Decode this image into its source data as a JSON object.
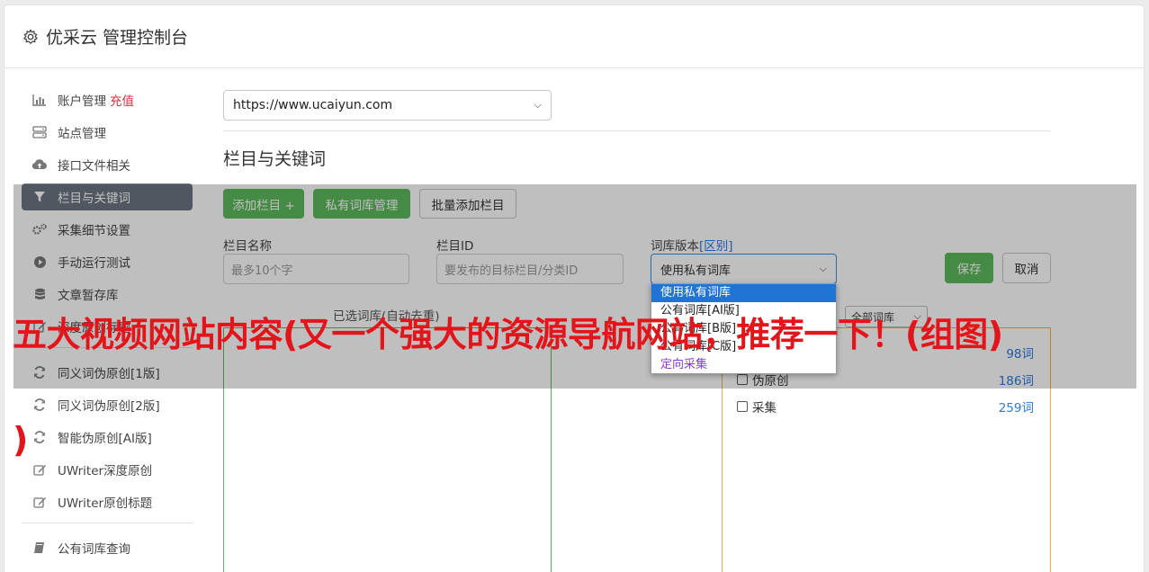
{
  "header": {
    "title": "优采云 管理控制台",
    "icon": "gear-icon"
  },
  "sidebar": {
    "items": [
      {
        "label": "账户管理",
        "icon": "bar-chart-icon",
        "extra": "充值"
      },
      {
        "label": "站点管理",
        "icon": "server-icon"
      },
      {
        "label": "接口文件相关",
        "icon": "cloud-upload-icon"
      },
      {
        "label": "栏目与关键词",
        "icon": "filter-icon",
        "active": true
      },
      {
        "label": "采集细节设置",
        "icon": "gears-icon"
      },
      {
        "label": "手动运行测试",
        "icon": "play-circle-icon"
      },
      {
        "label": "文章暂存库",
        "icon": "database-icon"
      },
      {
        "label": "深度原创标题",
        "icon": "edit-icon"
      }
    ],
    "items2": [
      {
        "label": "同义词伪原创[1版]",
        "icon": "refresh-icon"
      },
      {
        "label": "同义词伪原创[2版]",
        "icon": "refresh-icon"
      },
      {
        "label": "智能伪原创[AI版]",
        "icon": "refresh-icon"
      },
      {
        "label": "UWriter深度原创",
        "icon": "edit-icon"
      },
      {
        "label": "UWriter原创标题",
        "icon": "edit-icon"
      }
    ],
    "items3": [
      {
        "label": "公有词库查询",
        "icon": "book-icon"
      }
    ]
  },
  "main": {
    "site_select": "https://www.ucaiyun.com",
    "section_title": "栏目与关键词",
    "buttons": {
      "add_column": "添加栏目 +",
      "private_lib": "私有词库管理",
      "batch_add": "批量添加栏目"
    },
    "form": {
      "name_label": "栏目名称",
      "name_placeholder": "最多10个字",
      "id_label": "栏目ID",
      "id_placeholder": "要发布的目标栏目/分类ID",
      "version_label": "词库版本",
      "version_link": "[区别]",
      "version_value": "使用私有词库",
      "save": "保存",
      "cancel": "取消"
    },
    "selected_label": "已选词库(自动去重)",
    "filter_select": "全部词库",
    "dropdown_options": [
      "使用私有词库",
      "公有词库[AI版]",
      "公有词库[B版]",
      "公有词库[C版]",
      "定向采集"
    ],
    "libraries": [
      {
        "name": "",
        "count": "98词"
      },
      {
        "name": "伪原创",
        "count": "186词"
      },
      {
        "name": "采集",
        "count": "259词"
      }
    ]
  },
  "headline": {
    "line1": "五大视频网站内容(又一个强大的资源导航网站，推荐一下！(组图)",
    "line2": ")"
  },
  "colors": {
    "accent_green": "#5cb85c",
    "active_nav": "#6c7580",
    "headline_red": "#e4141b",
    "link_blue": "#2a7ae2"
  }
}
